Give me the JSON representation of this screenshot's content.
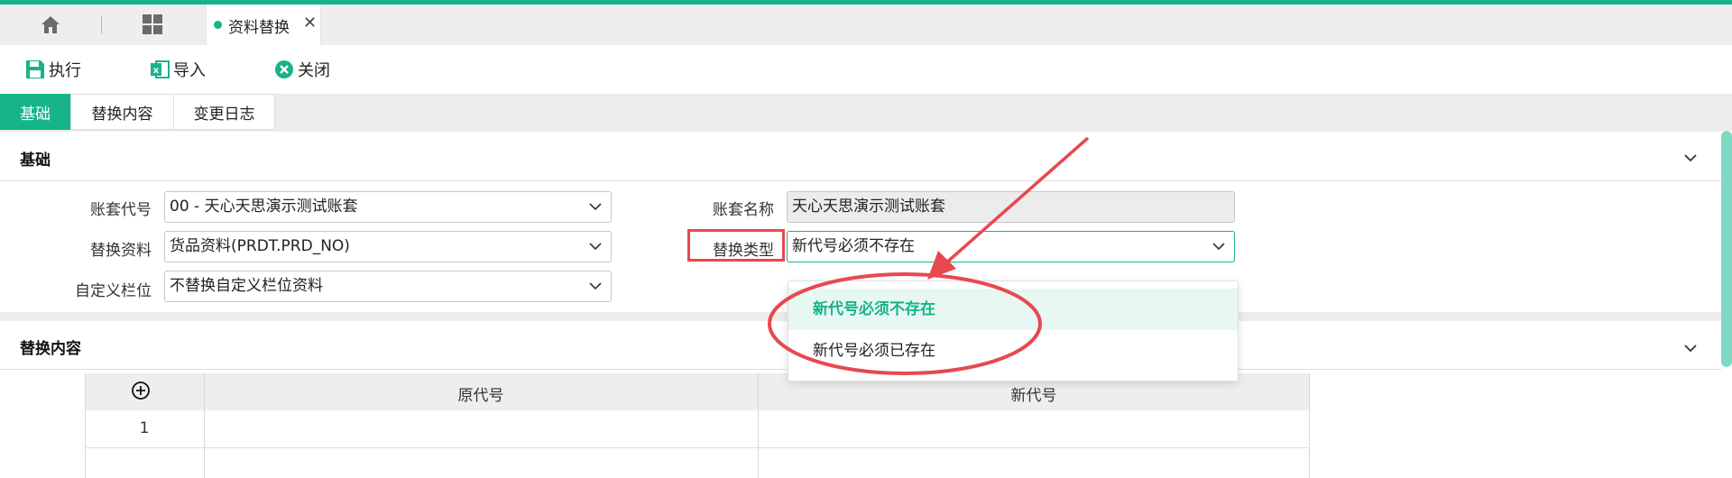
{
  "window_tab": {
    "label": "资料替换"
  },
  "toolbar": {
    "execute_label": "执行",
    "import_label": "导入",
    "close_label": "关闭"
  },
  "subtabs": [
    {
      "label": "基础",
      "active": true
    },
    {
      "label": "替换内容",
      "active": false
    },
    {
      "label": "变更日志",
      "active": false
    }
  ],
  "basic_section": {
    "title": "基础",
    "fields": {
      "account_code": {
        "label": "账套代号",
        "value": "00 - 天心天思演示测试账套"
      },
      "account_name": {
        "label": "账套名称",
        "value": "天心天思演示测试账套"
      },
      "replace_data": {
        "label": "替换资料",
        "value": "货品资料(PRDT.PRD_NO)"
      },
      "replace_type": {
        "label": "替换类型",
        "value": "新代号必须不存在"
      },
      "custom_field": {
        "label": "自定义栏位",
        "value": "不替换自定义栏位资料"
      }
    }
  },
  "dropdown": {
    "options": [
      {
        "label": "新代号必须不存在",
        "selected": true
      },
      {
        "label": "新代号必须已存在",
        "selected": false
      }
    ]
  },
  "replace_section": {
    "title": "替换内容",
    "columns": [
      "原代号",
      "新代号"
    ],
    "rows": [
      {
        "index": "1",
        "old": "",
        "new": ""
      }
    ]
  },
  "colors": {
    "accent": "#17b489",
    "annotation": "#e8484f"
  }
}
